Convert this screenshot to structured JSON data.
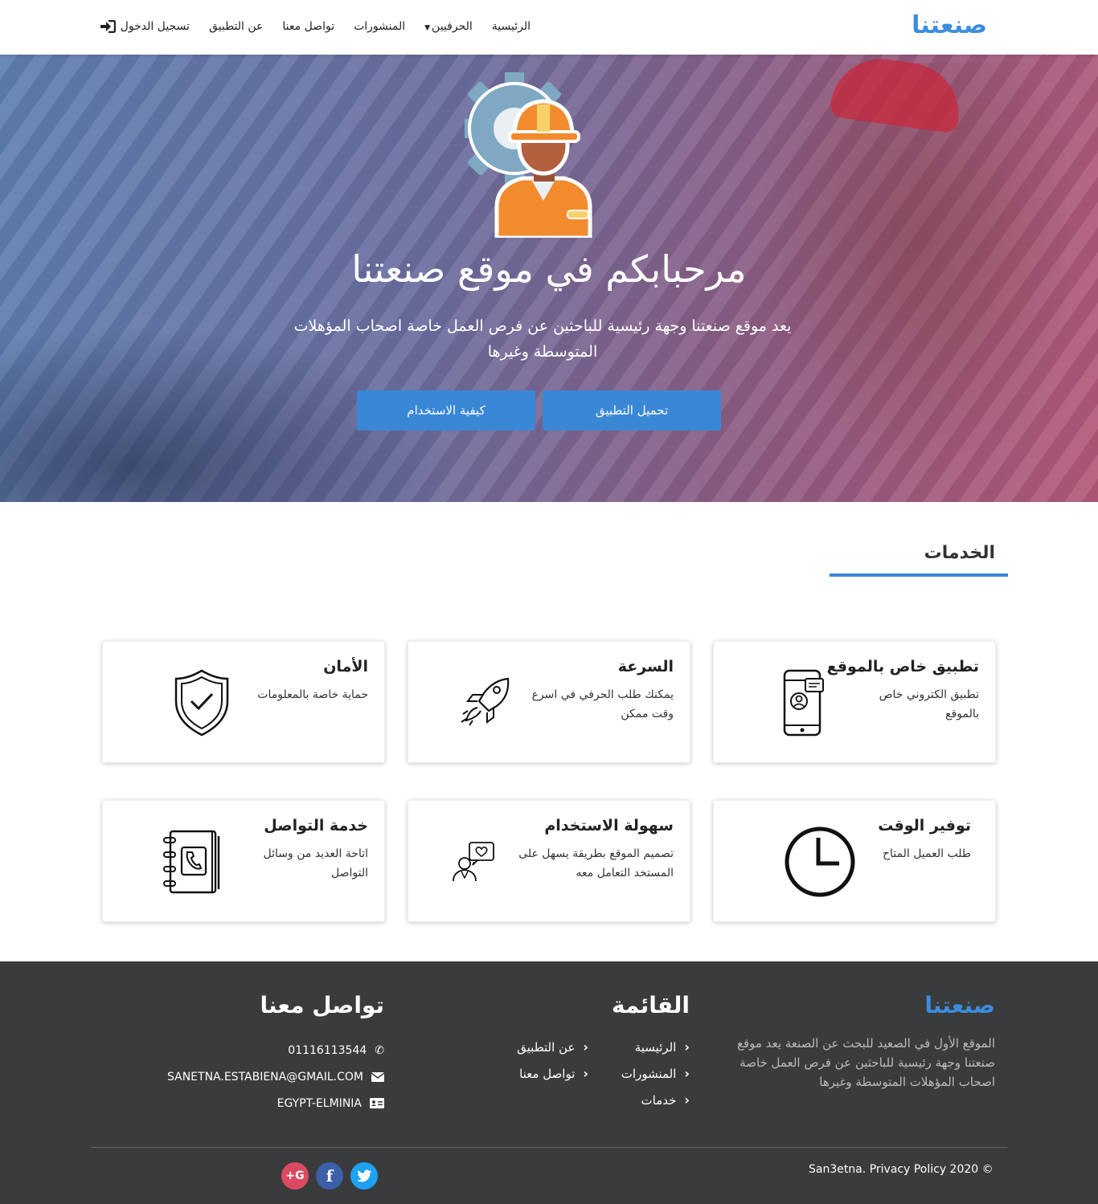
{
  "navbar": {
    "brand": "صنعتنا",
    "links": {
      "home": "الرئيسية",
      "craftsmen": "الحرفيين",
      "posts": "المنشورات",
      "contact": "تواصل معنا",
      "about": "عن التطبيق",
      "login": "تسجيل الدخول"
    }
  },
  "hero": {
    "title": "مرحبابكم في موقع صنعتنا",
    "subtitle": "يعد موقع صنعتنا وجهة رئيسية للباحثين عن فرص العمل خاصة اصحاب المؤهلات المتوسطة وغيرها",
    "download_button": "تحميل التطبيق",
    "howto_button": "كيفية الاستخدام"
  },
  "services": {
    "title": "الخدمات",
    "cards": [
      {
        "title": "تطبيق خاص بالموقع",
        "text": "تطبيق الكتروني خاص بالموقع",
        "icon": "smartphone-chat-icon"
      },
      {
        "title": "السرعة",
        "text": "يمكنك طلب الحرفي في اسرع وقت ممكن",
        "icon": "rocket-icon"
      },
      {
        "title": "الأمان",
        "text": "حماية خاصة بالمعلومات",
        "icon": "shield-check-icon"
      },
      {
        "title": "توفير الوقت",
        "text": "طلب العميل المتاح",
        "icon": "clock-icon"
      },
      {
        "title": "سهولة الاستخدام",
        "text": "تصميم الموقع بطريقة يسهل على المستخد التعامل معه",
        "icon": "user-heart-icon"
      },
      {
        "title": "خدمة التواصل",
        "text": "اتاحة العديد من وسائل التواصل",
        "icon": "phone-book-icon"
      }
    ]
  },
  "footer": {
    "brand": "صنعتنا",
    "about": "الموقع الأول في الصعيد للبحث عن الصنعة يعد موقع صنعتنا وجهة رئيسية للباحثين عن فرص العمل خاصة اصحاب المؤهلات المتوسطة وغيرها",
    "menu_title": "القائمة",
    "menu_col1": [
      "الرئيسية",
      "المنشورات",
      "خدمات"
    ],
    "menu_col2": [
      "عن التطبيق",
      "تواصل معنا"
    ],
    "contact_title": "تواصل معنا",
    "phone": "01116113544",
    "email": "SANETNA.ESTABIENA@GMAIL.COM",
    "address": "EGYPT-ELMINIA",
    "copyright": "San3etna. Privacy Policy 2020 ©",
    "social": [
      "google-plus-icon",
      "facebook-icon",
      "twitter-icon"
    ]
  },
  "colors": {
    "accent": "#3a87d6",
    "footer_bg": "#3a3b3d",
    "google": "#dc4a61",
    "facebook": "#3b5fa8",
    "twitter": "#1da1f2"
  }
}
